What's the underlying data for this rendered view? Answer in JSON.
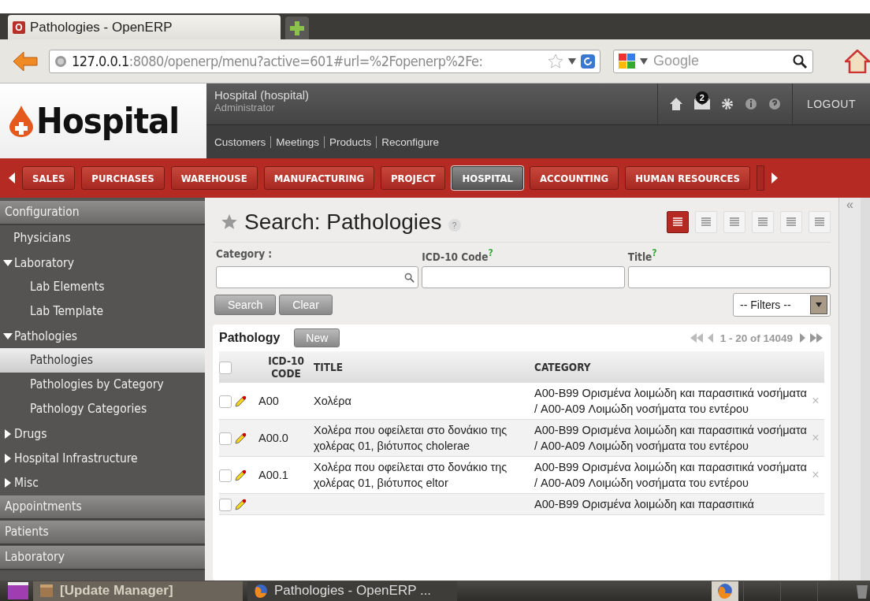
{
  "browser": {
    "tab_title": "Pathologies - OpenERP",
    "favicon_letter": "O",
    "url_host": "127.0.0.1",
    "url_rest": ":8080/openerp/menu?active=601#url=%2Fopenerp%2Fe:",
    "search_placeholder": "Google"
  },
  "header": {
    "logo_text": "Hospital",
    "company": "Hospital (hospital)",
    "user": "Administrator",
    "mail_count": "2",
    "logout": "LOGOUT",
    "shortcuts": [
      "Customers",
      "Meetings",
      "Products",
      "Reconfigure"
    ]
  },
  "menu": [
    {
      "label": "SALES",
      "selected": false
    },
    {
      "label": "PURCHASES",
      "selected": false
    },
    {
      "label": "WAREHOUSE",
      "selected": false
    },
    {
      "label": "MANUFACTURING",
      "selected": false
    },
    {
      "label": "PROJECT",
      "selected": false
    },
    {
      "label": "HOSPITAL",
      "selected": true
    },
    {
      "label": "ACCOUNTING",
      "selected": false
    },
    {
      "label": "HUMAN RESOURCES",
      "selected": false
    }
  ],
  "sidebar": [
    {
      "label": "Configuration",
      "children": [
        {
          "label": "Physicians",
          "selected": false
        },
        {
          "label": "Laboratory",
          "expanded": true,
          "children": [
            {
              "label": "Lab Elements",
              "selected": false
            },
            {
              "label": "Lab Template",
              "selected": false
            }
          ]
        },
        {
          "label": "Pathologies",
          "expanded": true,
          "children": [
            {
              "label": "Pathologies",
              "selected": true
            },
            {
              "label": "Pathologies by Category",
              "selected": false
            },
            {
              "label": "Pathology Categories",
              "selected": false
            }
          ]
        },
        {
          "label": "Drugs",
          "expanded": false
        },
        {
          "label": "Hospital Infrastructure",
          "expanded": false
        },
        {
          "label": "Misc",
          "expanded": false
        }
      ]
    },
    {
      "label": "Appointments"
    },
    {
      "label": "Patients"
    },
    {
      "label": "Laboratory"
    }
  ],
  "search": {
    "title": "Search: Pathologies",
    "help": "?",
    "views": [
      {
        "selected": true
      },
      {
        "selected": false
      },
      {
        "selected": false
      },
      {
        "selected": false
      },
      {
        "selected": false
      },
      {
        "selected": false
      }
    ],
    "fields": [
      {
        "label": "Category :",
        "search_icon": true
      },
      {
        "label": "ICD-10 Code",
        "help": "?",
        "search_icon": false
      },
      {
        "label": "Title",
        "help": "?",
        "search_icon": false
      }
    ],
    "buttons": [
      "Search",
      "Clear"
    ],
    "filter": "-- Filters --"
  },
  "list": {
    "title": "Pathology",
    "new_button": "New",
    "pager": "1 - 20 of 14049",
    "collapse": "«",
    "select_all_checked": false,
    "columns": [
      "ICD-10 CODE",
      "TITLE",
      "CATEGORY"
    ],
    "rows": [
      {
        "checked": false,
        "delete": "×",
        "code": "A00",
        "title": "Χολέρα",
        "category": "A00-B99 Ορισμένα λοιμώδη και παρασιτικά νοσήματα / A00-A09 Λοιμώδη νοσήματα του εντέρου"
      },
      {
        "checked": false,
        "delete": "×",
        "code": "A00.0",
        "title": "Χολέρα που οφείλεται στο δονάκιο της χολέρας 01, βιότυπος cholerae",
        "category": "A00-B99 Ορισμένα λοιμώδη και παρασιτικά νοσήματα / A00-A09 Λοιμώδη νοσήματα του εντέρου"
      },
      {
        "checked": false,
        "delete": "×",
        "code": "A00.1",
        "title": "Χολέρα που οφείλεται στο δονάκιο της χολέρας 01, βιότυπος eltor",
        "category": "A00-B99 Ορισμένα λοιμώδη και παρασιτικά νοσήματα / A00-A09 Λοιμώδη νοσήματα του εντέρου"
      },
      {
        "checked": false,
        "category": "A00-B99 Ορισμένα λοιμώδη και παρασιτικά"
      }
    ]
  },
  "taskbar": [
    {
      "label": "[Update Manager]",
      "kind": "box"
    },
    {
      "label": "Pathologies - OpenERP ...",
      "kind": "browser"
    }
  ]
}
